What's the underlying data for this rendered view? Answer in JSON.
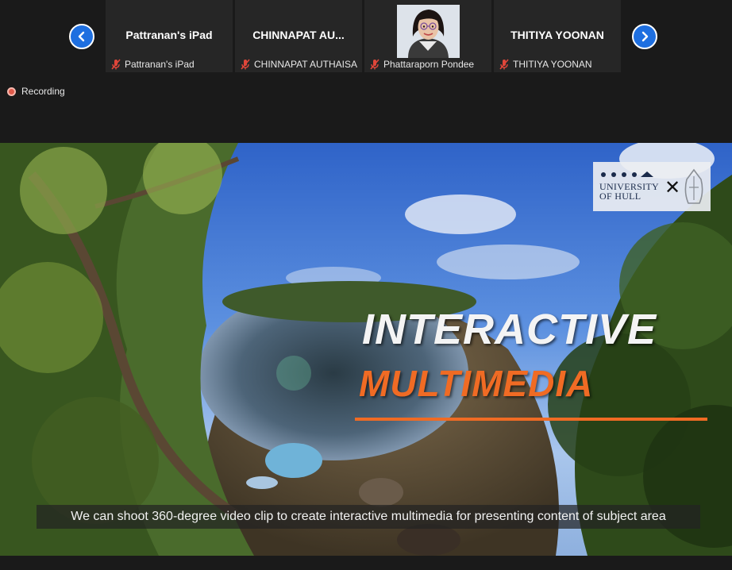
{
  "gallery": {
    "prev_icon": "chevron-left-icon",
    "next_icon": "chevron-right-icon",
    "participants": [
      {
        "display_name": "Pattranan's iPad",
        "footer_name": "Pattranan's iPad",
        "muted": true,
        "has_video": false
      },
      {
        "display_name": "CHINNAPAT AU...",
        "footer_name": "CHINNAPAT AUTHAISA",
        "muted": true,
        "has_video": false
      },
      {
        "display_name": "",
        "footer_name": "Phattaraporn Pondee",
        "muted": true,
        "has_video": true
      },
      {
        "display_name": "THITIYA YOONAN",
        "footer_name": "THITIYA YOONAN",
        "muted": true,
        "has_video": false
      }
    ]
  },
  "recording": {
    "label": "Recording",
    "color": "#e05a4a"
  },
  "shared_video": {
    "logo": {
      "line1": "UNIVERSITY",
      "line2": "OF HULL",
      "separator": "✕"
    },
    "title_line1": "INTERACTIVE",
    "title_line2": "MULTIMEDIA",
    "caption": "We can shoot 360-degree video clip to create interactive multimedia for presenting content of subject area",
    "accent_color": "#f06b24"
  },
  "colors": {
    "background": "#1a1a1a",
    "tile": "#262626",
    "nav_button": "#1e6fe0",
    "muted_icon": "#e0463a"
  }
}
